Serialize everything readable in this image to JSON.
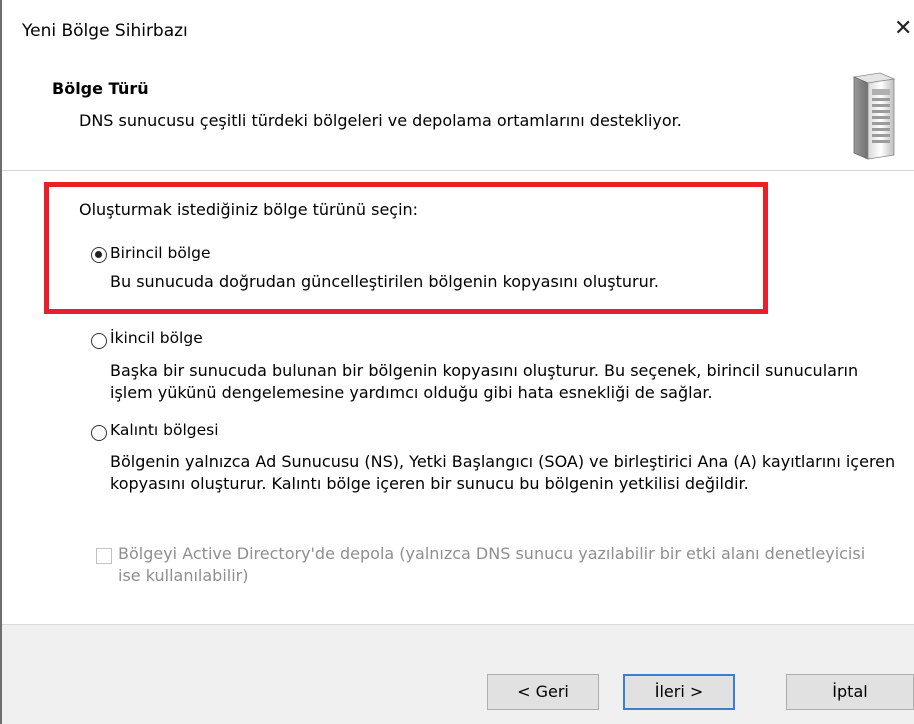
{
  "window": {
    "title": "Yeni Bölge Sihirbazı",
    "close_glyph": "✕"
  },
  "header": {
    "title": "Bölge Türü",
    "description": "DNS sunucusu çeşitli türdeki bölgeleri ve depolama ortamlarını destekliyor.",
    "icon": "server-icon"
  },
  "content": {
    "prompt": "Oluşturmak istediğiniz bölge türünü seçin:",
    "options": [
      {
        "label": "Birincil bölge",
        "description": "Bu sunucuda doğrudan güncelleştirilen bölgenin kopyasını oluşturur.",
        "selected": true
      },
      {
        "label": "İkincil bölge",
        "description": "Başka bir sunucuda bulunan bir bölgenin kopyasını oluşturur. Bu seçenek, birincil sunucuların işlem yükünü dengelemesine yardımcı olduğu gibi hata esnekliği de sağlar.",
        "selected": false
      },
      {
        "label": "Kalıntı bölgesi",
        "description": "Bölgenin yalnızca Ad Sunucusu (NS), Yetki Başlangıcı (SOA) ve birleştirici Ana (A) kayıtlarını içeren kopyasını oluşturur. Kalıntı bölge içeren bir sunucu bu bölgenin yetkilisi değildir.",
        "selected": false
      }
    ],
    "ad_checkbox": {
      "label": "Bölgeyi Active Directory'de depola (yalnızca DNS sunucu yazılabilir bir etki alanı denetleyicisi ise kullanılabilir)",
      "checked": false,
      "disabled": true
    }
  },
  "footer": {
    "back_label": "< Geri",
    "next_label": "İleri >",
    "cancel_label": "İptal"
  },
  "colors": {
    "highlight_border": "#e8202a",
    "default_button_border": "#3c7fd1"
  }
}
